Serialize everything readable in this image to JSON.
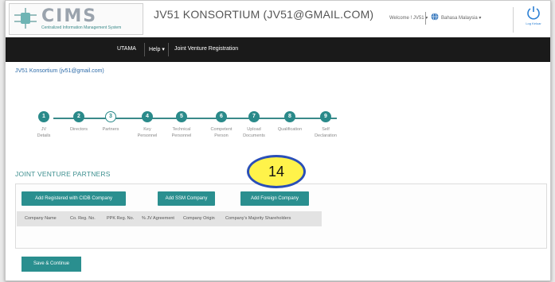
{
  "header": {
    "logo_title": "CIMS",
    "logo_subtitle": "Centralized Information Management System",
    "org_title": "JV51 KONSORTIUM (JV51@GMAIL.COM)",
    "welcome": "Welcome ! JV51 ▾",
    "language": "Bahasa Malaysia ▾",
    "logout_label": "Log Keluar"
  },
  "nav": {
    "items": [
      "UTAMA",
      "Help ▾",
      "Joint Venture Registration"
    ]
  },
  "breadcrumb": "JV51 Konsortium (jv51@gmail.com)",
  "steps": [
    {
      "num": "1",
      "label": "JV\nDetails"
    },
    {
      "num": "2",
      "label": "Directors"
    },
    {
      "num": "3",
      "label": "Partners"
    },
    {
      "num": "4",
      "label": "Key\nPersonnel"
    },
    {
      "num": "5",
      "label": "Technical\nPersonnel"
    },
    {
      "num": "6",
      "label": "Competent\nPerson"
    },
    {
      "num": "7",
      "label": "Upload\nDocuments"
    },
    {
      "num": "8",
      "label": "Qualification"
    },
    {
      "num": "9",
      "label": "Self\nDeclaration"
    }
  ],
  "section_title": "JOINT VENTURE PARTNERS",
  "buttons": {
    "add_cidb": "Add Registered with CIDB Company",
    "add_ssm": "Add SSM Company",
    "add_foreign": "Add Foreign Company",
    "save": "Save & Continue"
  },
  "table": {
    "columns": [
      "Company Name",
      "Co. Reg. No.",
      "PPK Reg. No.",
      "% JV Agreement",
      "Company Origin",
      "Company's Majority Shareholders"
    ]
  },
  "annotation": "14",
  "colors": {
    "accent": "#2a8f8f",
    "nav_bg": "#1a1a1a",
    "callout_fill": "#fff34a",
    "callout_border": "#2a4fb8"
  }
}
